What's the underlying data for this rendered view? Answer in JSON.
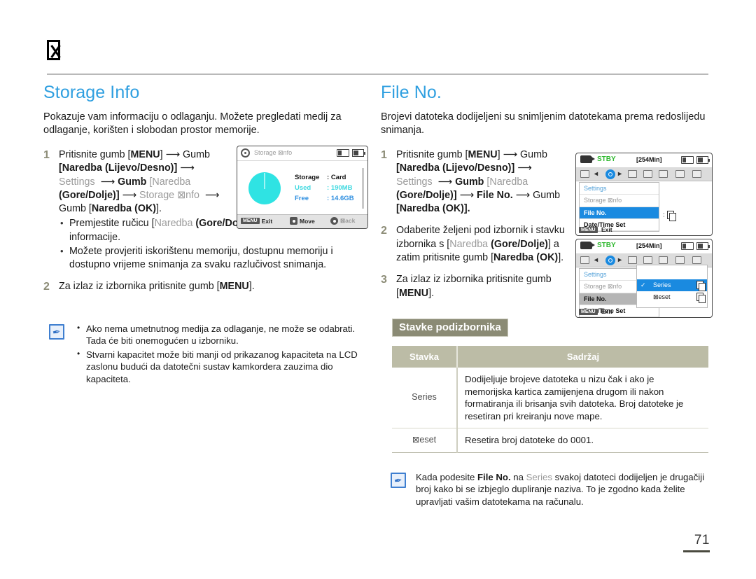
{
  "header": {
    "glyph_icon": "missing-glyph-box"
  },
  "page_number": "71",
  "left": {
    "title": "Storage Info",
    "intro": "Pokazuje vam informaciju o odlaganju. Možete pregledati medij za odlaganje, korišten i slobodan prostor memorije.",
    "steps": [
      {
        "num": "1",
        "line1_a": "Pritisnite gumb [",
        "line1_menu": "MENU",
        "line1_b": "] ",
        "line1_c": " Gumb",
        "line2": "[Naredba (Lijevo/Desno)]",
        "settings": "Settings",
        "gumb": "Gumb",
        "naredba": "[Naredba",
        "goredolje": "(Gore/Dolje)]",
        "storage_info": "Storage ⊠nfo",
        "gumb_ok_pre": "Gumb [",
        "gumb_ok": "Naredba (OK)",
        "gumb_ok_post": "]."
      },
      {
        "num": "2",
        "text_a": "Za izlaz iz izbornika pritisnite gumb [",
        "text_menu": "MENU",
        "text_b": "]."
      }
    ],
    "bullets": [
      {
        "a": "Premjestite ručicu [",
        "g": "Naredba",
        "b": "(Gore/Dolje)",
        "c": "] tza pregled željene informacije."
      },
      {
        "a": "Možete provjeriti iskorištenu memoriju, dostupnu memoriju i dostupno vrijeme snimanja za svaku razlučivost snimanja."
      }
    ],
    "note": [
      "Ako nema umetnutnog medija za odlaganje, ne može se odabrati. Tada će biti onemogućen u izborniku.",
      "Stvarni kapacitet može biti manji od prikazanog kapaciteta na LCD zaslonu budući da datotečni sustav kamkordera zauzima dio kapaciteta."
    ],
    "lcd": {
      "title": "Storage ⊠nfo",
      "gear_icon": "gear-icon",
      "card_icon": "memory-card-icon",
      "battery_icon": "battery-icon",
      "rows": [
        {
          "key": "Storage",
          "sep": ":",
          "value": "Card"
        },
        {
          "key": "Used",
          "sep": ":",
          "value": "190MB"
        },
        {
          "key": "Free",
          "sep": ":",
          "value": "14.6GB"
        }
      ],
      "bottom": [
        {
          "tag": "MENU",
          "label": "Exit"
        },
        {
          "tag": "dpad",
          "label": "Move"
        },
        {
          "tag": "ok",
          "label": "⊠ack"
        }
      ],
      "pie_color": "#2fe3e3"
    }
  },
  "right": {
    "title": "File No.",
    "intro": "Brojevi datoteka dodijeljeni su snimljenim datotekama prema redoslijedu snimanja.",
    "steps": [
      {
        "num": "1",
        "line1_a": "Pritisnite gumb [",
        "line1_menu": "MENU",
        "line1_b": "] ",
        "line1_c": " Gumb",
        "line2": "[Naredba (Lijevo/Desno)]",
        "settings": "Settings",
        "gumb": "Gumb",
        "naredba": "[Naredba",
        "goredolje": "(Gore/Dolje)]",
        "fileno": "File No.",
        "gumb_tail": "Gumb",
        "gumb_ok": "[Naredba (OK)]."
      },
      {
        "num": "2",
        "a": "Odaberite željeni pod izbornik i stavku izbornika s [",
        "g": "Naredba",
        "b": "(Gore/Dolje)",
        "c": "] a zatim pritisnite gumb [",
        "d": "Naredba (OK)",
        "e": "]."
      },
      {
        "num": "3",
        "a": "Za izlaz iz izbornika pritisnite gumb [",
        "b": "MENU",
        "c": "]."
      }
    ],
    "submenu_banner": "Stavke podizbornika",
    "table": {
      "headers": [
        "Stavka",
        "Sadržaj"
      ],
      "rows": [
        {
          "item": "Series",
          "content": "Dodijeljuje brojeve datoteka u nizu čak i ako je memorijska kartica zamijenjena drugom ili nakon formatiranja ili brisanja svih datoteka. Broj datoteke je resetiran pri kreiranju nove mape."
        },
        {
          "item": "⊠eset",
          "content": "Resetira broj datoteke do 0001."
        }
      ]
    },
    "note": {
      "a": "Kada podesite ",
      "b": "File No.",
      "c": " na ",
      "g": "Series",
      "d": " svakoj datoteci dodijeljen je drugačiji broj kako bi se izbjeglo dupliranje naziva. To je zgodno kada želite upravljati vašim datotekama na računalu."
    },
    "lcd1": {
      "status": "STBY",
      "time": "[254Min]",
      "menu_items": [
        {
          "label": "Settings",
          "state": "head"
        },
        {
          "label": "Storage ⊠nfo",
          "state": "dim"
        },
        {
          "label": "File No.",
          "state": "sel"
        },
        {
          "label": "Date/Time Set",
          "state": "bold"
        }
      ],
      "value_sep": ":",
      "exit_tag": "MENU",
      "exit_label": "Exit"
    },
    "lcd2": {
      "status": "STBY",
      "time": "[254Min]",
      "menu_items": [
        {
          "label": "Settings",
          "state": "head"
        },
        {
          "label": "Storage ⊠nfo",
          "state": "dim"
        },
        {
          "label": "File No.",
          "state": "selgray"
        },
        {
          "label": "Date/Time Set",
          "state": "bold"
        }
      ],
      "popup_items": [
        {
          "label": "Series",
          "selected": true,
          "check": "✓"
        },
        {
          "label": "⊠eset",
          "selected": false,
          "check": ""
        }
      ],
      "exit_tag": "MENU",
      "exit_label": "Exit"
    }
  },
  "colors": {
    "heading": "#2f9fe0",
    "step_number": "#8d8d78",
    "table_header": "#bcbca6",
    "banner": "#8b8b75",
    "lcd_select": "#1a8ae0",
    "stby_green": "#2fb82f"
  }
}
